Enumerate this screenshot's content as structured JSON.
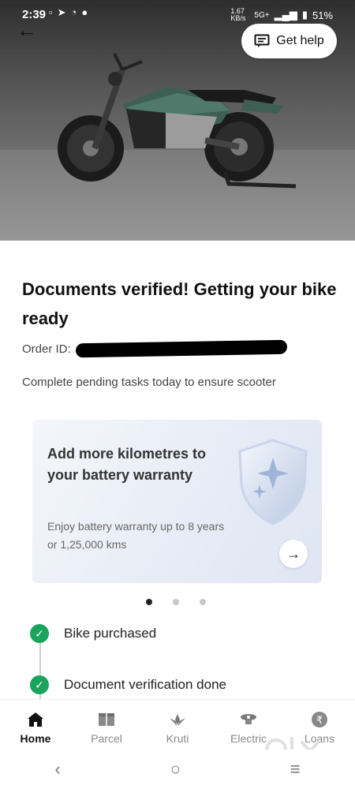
{
  "status_bar": {
    "time": "2:39",
    "network": "5G+",
    "speed": "1.67 KB/s",
    "battery": "51%"
  },
  "header": {
    "back_icon": "arrow-left-icon",
    "help_label": "Get help",
    "help_icon": "chat-icon"
  },
  "hero": {
    "image": "electric-motorcycle-image"
  },
  "main": {
    "title": "Documents verified! Getting your bike ready",
    "order_label": "Order ID:",
    "pending_text": "Complete pending tasks today to ensure scooter"
  },
  "promo_card": {
    "title": "Add more kilometres to your battery warranty",
    "subtitle": "Enjoy battery warranty up to 8 years or 1,25,000 kms",
    "icon": "shield-sparkle-icon",
    "arrow_icon": "arrow-right-icon"
  },
  "carousel": {
    "count": 3,
    "active_index": 0
  },
  "steps": [
    {
      "label": "Bike purchased",
      "status": "done"
    },
    {
      "label": "Document verification done",
      "status": "done"
    }
  ],
  "bottom_nav": [
    {
      "label": "Home",
      "icon": "home-icon",
      "active": true
    },
    {
      "label": "Parcel",
      "icon": "parcel-icon",
      "active": false
    },
    {
      "label": "Kruti",
      "icon": "kruti-icon",
      "active": false
    },
    {
      "label": "Electric",
      "icon": "electric-icon",
      "active": false
    },
    {
      "label": "Loans",
      "icon": "rupee-icon",
      "active": false
    }
  ],
  "colors": {
    "accent_green": "#19a35b",
    "card_bg": "#e7ecf6"
  },
  "watermark": "olx"
}
